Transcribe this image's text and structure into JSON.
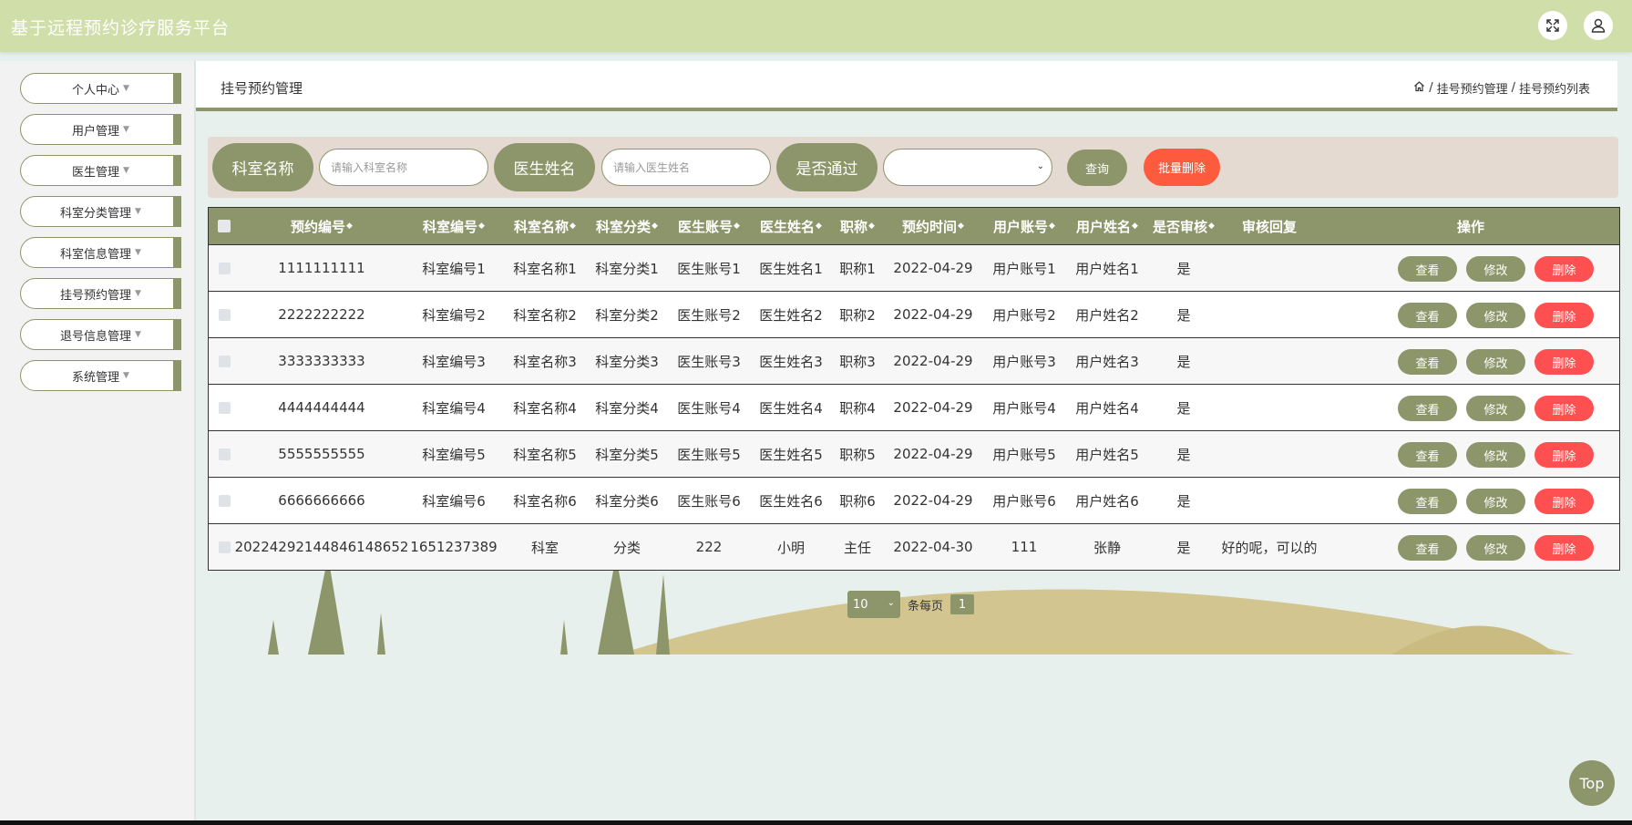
{
  "header": {
    "app_title": "基于远程预约诊疗服务平台",
    "fullscreen_icon": "expand-icon",
    "user_icon": "user-icon"
  },
  "sidebar": {
    "items": [
      {
        "label": "个人中心"
      },
      {
        "label": "用户管理"
      },
      {
        "label": "医生管理"
      },
      {
        "label": "科室分类管理"
      },
      {
        "label": "科室信息管理"
      },
      {
        "label": "挂号预约管理"
      },
      {
        "label": "退号信息管理"
      },
      {
        "label": "系统管理"
      }
    ]
  },
  "page": {
    "title": "挂号预约管理",
    "breadcrumb": {
      "home_icon": "home-icon",
      "sep": "/",
      "level1": "挂号预约管理",
      "level2": "挂号预约列表"
    }
  },
  "filters": {
    "dept_label": "科室名称",
    "dept_placeholder": "请输入科室名称",
    "doctor_label": "医生姓名",
    "doctor_placeholder": "请输入医生姓名",
    "approved_label": "是否通过",
    "approved_value": "",
    "query_label": "查询",
    "batch_delete_label": "批量删除"
  },
  "table": {
    "columns": [
      "预约编号",
      "科室编号",
      "科室名称",
      "科室分类",
      "医生账号",
      "医生姓名",
      "职称",
      "预约时间",
      "用户账号",
      "用户姓名",
      "是否审核",
      "审核回复",
      "操作"
    ],
    "sort_glyph": "◆",
    "rows": [
      [
        "1111111111",
        "科室编号1",
        "科室名称1",
        "科室分类1",
        "医生账号1",
        "医生姓名1",
        "职称1",
        "2022-04-29",
        "用户账号1",
        "用户姓名1",
        "是",
        ""
      ],
      [
        "2222222222",
        "科室编号2",
        "科室名称2",
        "科室分类2",
        "医生账号2",
        "医生姓名2",
        "职称2",
        "2022-04-29",
        "用户账号2",
        "用户姓名2",
        "是",
        ""
      ],
      [
        "3333333333",
        "科室编号3",
        "科室名称3",
        "科室分类3",
        "医生账号3",
        "医生姓名3",
        "职称3",
        "2022-04-29",
        "用户账号3",
        "用户姓名3",
        "是",
        ""
      ],
      [
        "4444444444",
        "科室编号4",
        "科室名称4",
        "科室分类4",
        "医生账号4",
        "医生姓名4",
        "职称4",
        "2022-04-29",
        "用户账号4",
        "用户姓名4",
        "是",
        ""
      ],
      [
        "5555555555",
        "科室编号5",
        "科室名称5",
        "科室分类5",
        "医生账号5",
        "医生姓名5",
        "职称5",
        "2022-04-29",
        "用户账号5",
        "用户姓名5",
        "是",
        ""
      ],
      [
        "6666666666",
        "科室编号6",
        "科室名称6",
        "科室分类6",
        "医生账号6",
        "医生姓名6",
        "职称6",
        "2022-04-29",
        "用户账号6",
        "用户姓名6",
        "是",
        ""
      ],
      [
        "20224292144846148652",
        "1651237389",
        "科室",
        "分类",
        "222",
        "小明",
        "主任",
        "2022-04-30",
        "111",
        "张静",
        "是",
        "好的呢，可以的"
      ]
    ],
    "actions": {
      "view": "查看",
      "edit": "修改",
      "delete": "删除"
    }
  },
  "pagination": {
    "page_size": "10",
    "per_page_text": "条每页",
    "current_page": "1"
  },
  "back_to_top": "Top",
  "colors": {
    "primary": "#8d956a",
    "header": "#d0dfa9",
    "danger": "#fe4f51",
    "batch": "#fe5a3e",
    "filter_bg": "#e4dad2",
    "page_bg": "#e7f0ec"
  }
}
